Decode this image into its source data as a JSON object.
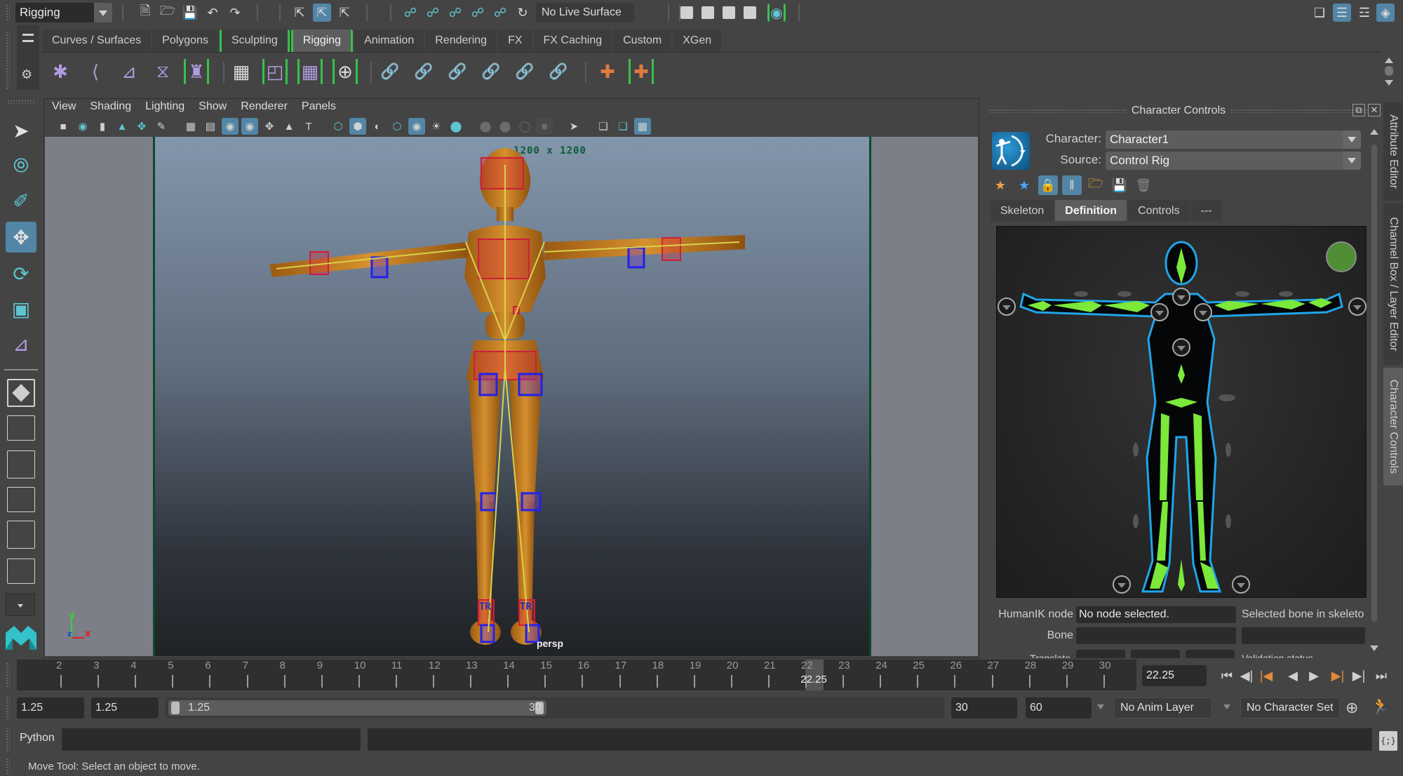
{
  "status_line": {
    "mode": "Rigging",
    "live_surface": "No Live Surface",
    "icons": [
      "new-scene-icon",
      "open-scene-icon",
      "save-scene-icon",
      "undo-icon",
      "redo-icon",
      "select-hierarchy-icon",
      "select-object-icon",
      "select-component-icon",
      "snap-grid-icon",
      "snap-curve-icon",
      "snap-point-icon",
      "snap-view-plane-icon",
      "snap-live-icon",
      "snap-pivot-icon",
      "render-view-icon",
      "render-frame-icon",
      "ipr-render-icon",
      "render-settings-icon",
      "hypershade-icon",
      "modeling-toolkit-icon",
      "attribute-editor-toggle-icon",
      "tool-settings-toggle-icon",
      "channel-box-toggle-icon"
    ]
  },
  "shelf": {
    "tabs": [
      "Curves / Surfaces",
      "Polygons",
      "Sculpting",
      "Rigging",
      "Animation",
      "Rendering",
      "FX",
      "FX Caching",
      "Custom",
      "XGen"
    ],
    "active_tab": "Rigging",
    "icons": [
      "joint-tool",
      "insert-joint",
      "mirror-joint",
      "ik-handle",
      "quick-rig",
      "bind-skin",
      "paint-skin-weights",
      "lattice",
      "cluster",
      "parent-constraint",
      "point-constraint",
      "orient-constraint",
      "scale-constraint",
      "aim-constraint",
      "pole-vector-constraint",
      "humanik-create",
      "humanik-character-controls"
    ]
  },
  "toolbox": {
    "tools": [
      "select-tool",
      "lasso-tool",
      "paint-select-tool",
      "move-tool",
      "rotate-tool",
      "scale-tool",
      "last-tool"
    ],
    "active_tool": "move-tool",
    "layouts": [
      "single-perspective",
      "four-view",
      "outliner-persp",
      "persp-graph",
      "hypershade-persp",
      "persp-graph-hypergraph"
    ]
  },
  "viewport": {
    "menu": [
      "View",
      "Shading",
      "Lighting",
      "Show",
      "Renderer",
      "Panels"
    ],
    "resolution_label": "1200 x 1200",
    "camera_label": "persp",
    "axis": {
      "x": "x",
      "y": "y",
      "z": "z"
    }
  },
  "character_controls": {
    "title": "Character Controls",
    "character_label": "Character:",
    "character_value": "Character1",
    "source_label": "Source:",
    "source_value": "Control Rig",
    "tabs": [
      "Skeleton",
      "Definition",
      "Controls",
      "---"
    ],
    "active_tab": "Definition",
    "status_color": "#4f8e35",
    "humanik_node_label": "HumanIK node",
    "humanik_node_value": "No node selected.",
    "selected_bone_label": "Selected bone in skeleto",
    "bone_label": "Bone",
    "translate_label": "Translate",
    "validation_label": "Validation status"
  },
  "side_tabs": [
    "Attribute Editor",
    "Channel Box / Layer Editor",
    "Character Controls"
  ],
  "active_side_tab": "Character Controls",
  "time_slider": {
    "ticks": [
      "2",
      "3",
      "4",
      "5",
      "6",
      "7",
      "8",
      "9",
      "10",
      "11",
      "12",
      "13",
      "14",
      "15",
      "16",
      "17",
      "18",
      "19",
      "20",
      "21",
      "22",
      "23",
      "24",
      "25",
      "26",
      "27",
      "28",
      "29",
      "30"
    ],
    "current_time": "22.25",
    "playhead_label": "22.25"
  },
  "range_slider": {
    "start_time": "1.25",
    "playback_start": "1.25",
    "range_start_label": "1.25",
    "range_end_label": "30",
    "playback_end": "30",
    "end_time": "60",
    "anim_layer": "No Anim Layer",
    "character_set": "No Character Set"
  },
  "command_line": {
    "language": "Python"
  },
  "help_line": "Move Tool: Select an object to move.",
  "colors": {
    "accent": "#5285a6",
    "shelf_bracket": "#38c14a",
    "hik_bone": "#7be83a",
    "hik_body_outline": "#1ea6ea"
  }
}
